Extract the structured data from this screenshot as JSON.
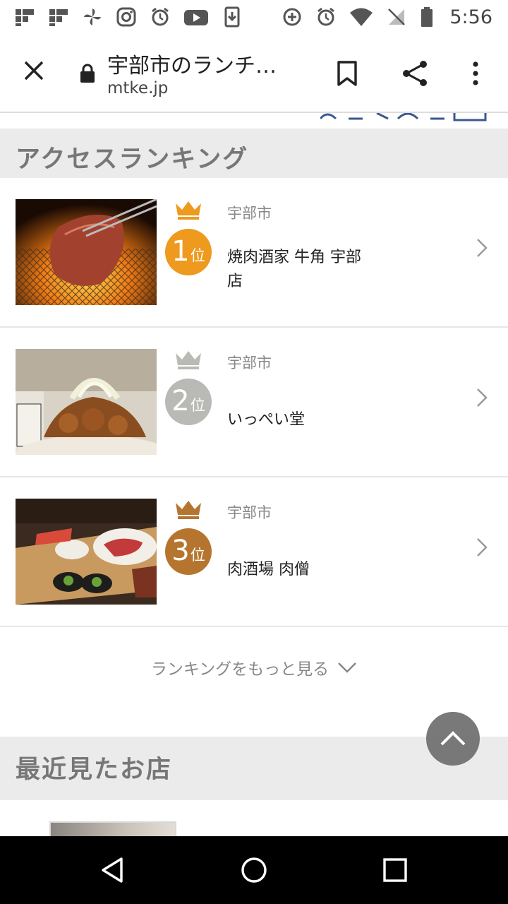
{
  "status_bar": {
    "time": "5:56",
    "left_icons": [
      "flipboard-icon",
      "flipboard-icon",
      "pinwheel-icon",
      "instagram-icon",
      "alarm-icon",
      "youtube-icon",
      "download-icon"
    ],
    "right_icons": [
      "data-saver-icon",
      "alarm-icon",
      "wifi-icon",
      "no-sim-icon",
      "battery-icon"
    ]
  },
  "browser": {
    "page_title": "宇部市のランチ…",
    "host": "mtke.jp"
  },
  "access_ranking": {
    "title": "アクセスランキング",
    "items": [
      {
        "rank": "1",
        "rank_suffix": "位",
        "area": "宇部市",
        "name": "焼肉酒家 牛角 宇部店",
        "badge_color": "#ee9a1e",
        "crown_color": "#ee9a1e",
        "image": "grilled-meat-photo"
      },
      {
        "rank": "2",
        "rank_suffix": "位",
        "area": "宇部市",
        "name": "いっぺい堂",
        "badge_color": "#b9b9b5",
        "crown_color": "#b9b9b5",
        "image": "fried-chicken-photo"
      },
      {
        "rank": "3",
        "rank_suffix": "位",
        "area": "宇部市",
        "name": "肉酒場 肉僧",
        "badge_color": "#b6752f",
        "crown_color": "#b6752f",
        "image": "meat-platter-photo"
      }
    ],
    "more_label": "ランキングをもっと見る"
  },
  "recently_viewed": {
    "title": "最近見たお店"
  },
  "nav_bar": {
    "buttons": [
      "back-icon",
      "home-icon",
      "recents-icon"
    ]
  }
}
